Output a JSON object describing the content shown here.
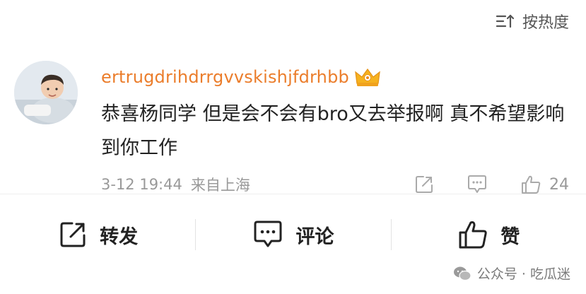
{
  "sort": {
    "label": "按热度",
    "icon": "sort-icon"
  },
  "comment": {
    "username": "ertrugdrihdrrgvvskishjfdrhbb",
    "badge_icon": "crown-badge-icon",
    "text": "恭喜杨同学 但是会不会有bro又去举报啊 真不希望影响到你工作",
    "timestamp": "3-12 19:44",
    "source": "来自上海",
    "like_count": "24"
  },
  "actions": {
    "repost_label": "转发",
    "comment_label": "评论",
    "like_label": "赞"
  },
  "watermark": {
    "text": "公众号 · 吃瓜迷"
  },
  "colors": {
    "username": "#eb7d2b",
    "text": "#222222",
    "meta": "#999999"
  }
}
